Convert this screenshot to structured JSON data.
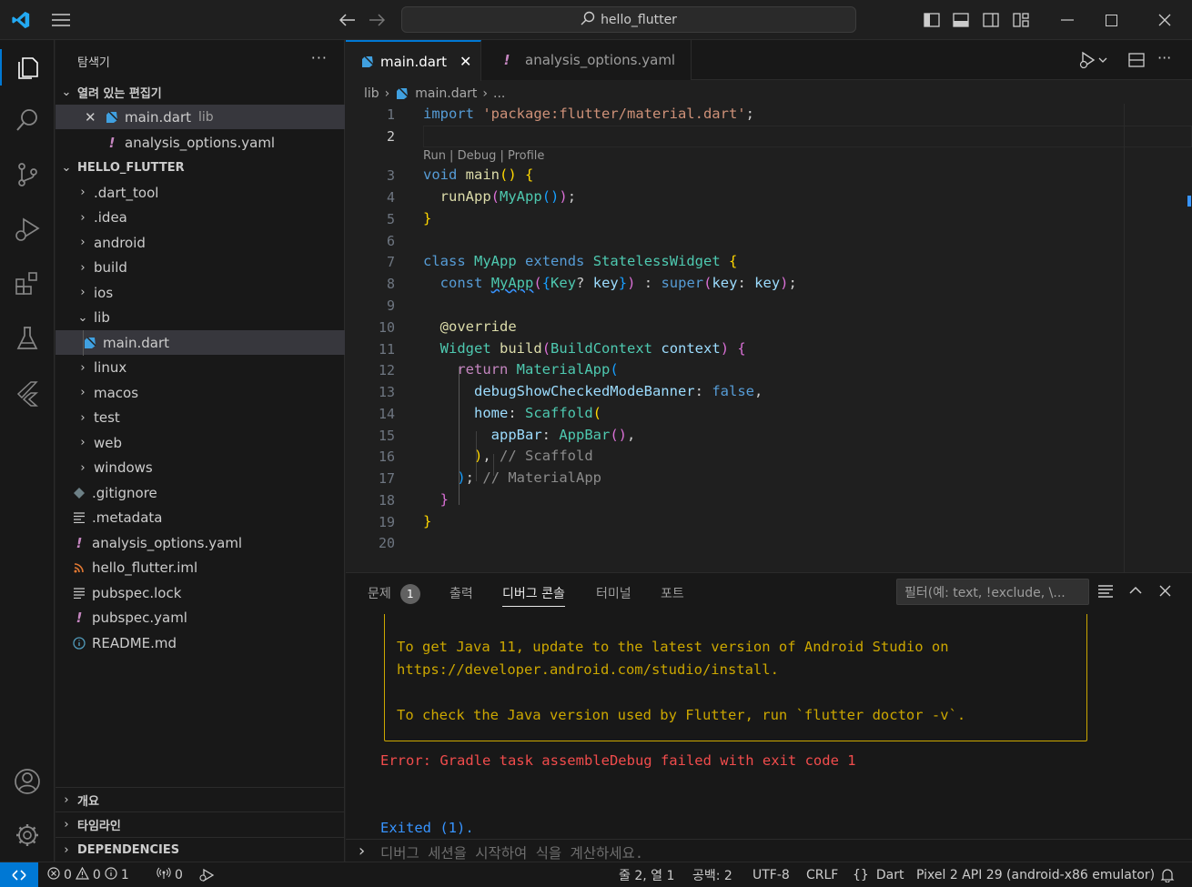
{
  "titlebar": {
    "search_text": "hello_flutter"
  },
  "sidebar": {
    "title": "탐색기",
    "more": "···",
    "open_editors": {
      "header": "열려 있는 편집기",
      "items": [
        {
          "name": "main.dart",
          "desc": "lib"
        },
        {
          "name": "analysis_options.yaml",
          "desc": ""
        }
      ]
    },
    "project": {
      "header": "HELLO_FLUTTER",
      "items": [
        {
          "name": ".dart_tool"
        },
        {
          "name": ".idea"
        },
        {
          "name": "android"
        },
        {
          "name": "build"
        },
        {
          "name": "ios"
        },
        {
          "name": "lib"
        },
        {
          "name": "main.dart"
        },
        {
          "name": "linux"
        },
        {
          "name": "macos"
        },
        {
          "name": "test"
        },
        {
          "name": "web"
        },
        {
          "name": "windows"
        },
        {
          "name": ".gitignore"
        },
        {
          "name": ".metadata"
        },
        {
          "name": "analysis_options.yaml"
        },
        {
          "name": "hello_flutter.iml"
        },
        {
          "name": "pubspec.lock"
        },
        {
          "name": "pubspec.yaml"
        },
        {
          "name": "README.md"
        }
      ]
    },
    "outline": "개요",
    "timeline": "타임라인",
    "dependencies": "DEPENDENCIES"
  },
  "editor": {
    "tabs": [
      {
        "label": "main.dart",
        "active": true
      },
      {
        "label": "analysis_options.yaml",
        "active": false
      }
    ],
    "breadcrumb": {
      "folder": "lib",
      "file": "main.dart",
      "more": "..."
    },
    "codelens": "Run | Debug | Profile",
    "line_numbers": [
      "1",
      "2",
      "3",
      "4",
      "5",
      "6",
      "7",
      "8",
      "9",
      "10",
      "11",
      "12",
      "13",
      "14",
      "15",
      "16",
      "17",
      "18",
      "19",
      "20"
    ],
    "current_line": "2"
  },
  "panel": {
    "tabs": [
      "문제",
      "출력",
      "디버그 콘솔",
      "터미널",
      "포트"
    ],
    "problems_count": "1",
    "filter_placeholder": "필터(예: text, !exclude, \\...",
    "output": {
      "line1": "To get Java 11, update to the latest version of Android Studio on",
      "line2": "https://developer.android.com/studio/install.",
      "line3": "To check the Java version used by Flutter, run `flutter doctor -v`.",
      "error": "Error: Gradle task assembleDebug failed with exit code 1",
      "exited": "Exited (1)."
    },
    "input_placeholder": "디버그 세션을 시작하여 식을 계산하세요."
  },
  "statusbar": {
    "errors": "0",
    "warnings": "0",
    "infos": "1",
    "ports": "0",
    "position": "줄 2, 열 1",
    "spaces": "공백: 2",
    "encoding": "UTF-8",
    "eol": "CRLF",
    "language": "Dart",
    "device": "Pixel 2 API 29 (android-x86 emulator)"
  }
}
